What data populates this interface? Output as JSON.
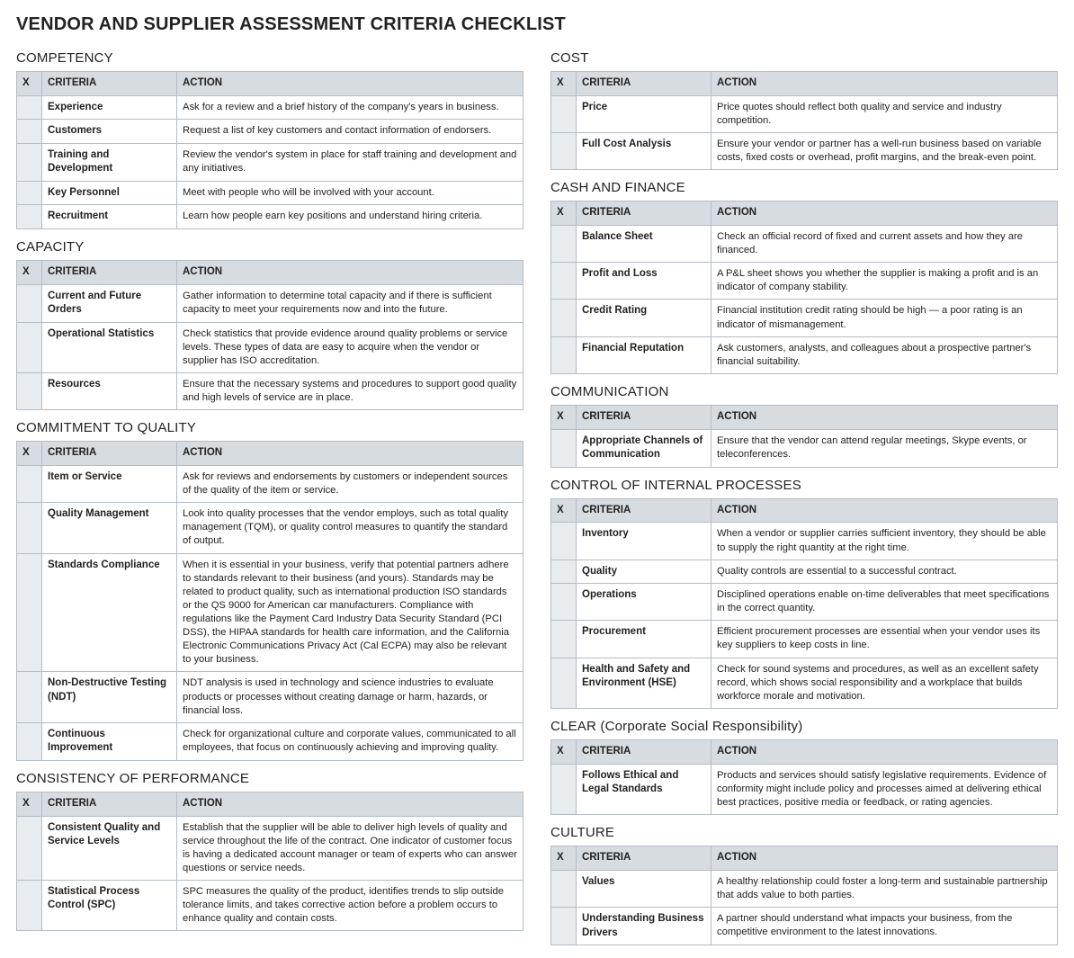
{
  "title": "VENDOR AND SUPPLIER ASSESSMENT CRITERIA CHECKLIST",
  "headers": {
    "x": "X",
    "criteria": "CRITERIA",
    "action": "ACTION"
  },
  "left": [
    {
      "name": "COMPETENCY",
      "rows": [
        {
          "criteria": "Experience",
          "action": "Ask for a review and a brief history of the company's years in business."
        },
        {
          "criteria": "Customers",
          "action": "Request a list of key customers and contact information of endorsers."
        },
        {
          "criteria": "Training and Development",
          "action": "Review the vendor's system in place for staff training and development and any initiatives."
        },
        {
          "criteria": "Key Personnel",
          "action": "Meet with people who will be involved with your account."
        },
        {
          "criteria": "Recruitment",
          "action": "Learn how people earn key positions and understand hiring criteria."
        }
      ]
    },
    {
      "name": "CAPACITY",
      "rows": [
        {
          "criteria": "Current and Future Orders",
          "action": "Gather information to determine total capacity and if there is sufficient capacity to meet your requirements now and into the future."
        },
        {
          "criteria": "Operational Statistics",
          "action": "Check statistics that provide evidence around quality problems or service levels. These types of data are easy to acquire when the vendor or supplier has ISO accreditation."
        },
        {
          "criteria": "Resources",
          "action": "Ensure that the necessary systems and procedures to support good quality and high levels of service are in place."
        }
      ]
    },
    {
      "name": "COMMITMENT TO QUALITY",
      "rows": [
        {
          "criteria": "Item or Service",
          "action": "Ask for reviews and endorsements by customers or independent sources of the quality of the item or service."
        },
        {
          "criteria": "Quality Management",
          "action": "Look into quality processes that the vendor employs, such as total quality management (TQM), or quality control measures to quantify the standard of output."
        },
        {
          "criteria": "Standards Compliance",
          "action": "When it is essential in your business, verify that potential partners adhere to standards relevant to their business (and yours). Standards may be related to product quality, such as international production ISO standards or the QS 9000 for American car manufacturers. Compliance with regulations like the Payment Card Industry Data Security Standard (PCI DSS), the HIPAA standards for health care information, and the California Electronic Communications Privacy Act (Cal ECPA) may also be relevant to your business."
        },
        {
          "criteria": "Non-Destructive Testing (NDT)",
          "action": "NDT analysis is used in technology and science industries to evaluate products or processes without creating damage or harm, hazards, or financial loss."
        },
        {
          "criteria": "Continuous Improvement",
          "action": "Check for organizational culture and corporate values, communicated to all employees, that focus on continuously achieving and improving quality."
        }
      ]
    },
    {
      "name": "CONSISTENCY OF PERFORMANCE",
      "rows": [
        {
          "criteria": "Consistent Quality and Service Levels",
          "action": "Establish that the supplier will be able to deliver high levels of quality and service throughout the life of the contract. One indicator of customer focus is having a dedicated account manager or team of experts who can answer questions or service needs."
        },
        {
          "criteria": "Statistical Process Control (SPC)",
          "action": "SPC measures the quality of the product, identifies trends to slip outside tolerance limits, and takes corrective action before a problem occurs to enhance quality and contain costs."
        }
      ]
    }
  ],
  "right": [
    {
      "name": "COST",
      "rows": [
        {
          "criteria": "Price",
          "action": "Price quotes should reflect both quality and service and industry competition."
        },
        {
          "criteria": "Full Cost Analysis",
          "action": "Ensure your vendor or partner has a well-run business based on variable costs, fixed costs or overhead, profit margins, and the break-even point."
        }
      ]
    },
    {
      "name": "CASH AND FINANCE",
      "rows": [
        {
          "criteria": "Balance Sheet",
          "action": "Check an official record of fixed and current assets and how they are financed."
        },
        {
          "criteria": "Profit and Loss",
          "action": "A P&L sheet shows you whether the supplier is making a profit and is an indicator of company stability."
        },
        {
          "criteria": "Credit Rating",
          "action": "Financial institution credit rating should be high — a poor rating is an indicator of mismanagement."
        },
        {
          "criteria": "Financial Reputation",
          "action": "Ask customers, analysts, and colleagues about a prospective partner's financial suitability."
        }
      ]
    },
    {
      "name": "COMMUNICATION",
      "rows": [
        {
          "criteria": "Appropriate Channels of Communication",
          "action": "Ensure that the vendor can attend regular meetings, Skype events, or teleconferences."
        }
      ]
    },
    {
      "name": "CONTROL OF INTERNAL PROCESSES",
      "rows": [
        {
          "criteria": "Inventory",
          "action": "When a vendor or supplier carries sufficient inventory, they should be able to supply the right quantity at the right time."
        },
        {
          "criteria": "Quality",
          "action": "Quality controls are essential to a successful contract."
        },
        {
          "criteria": "Operations",
          "action": "Disciplined operations enable on-time deliverables that meet specifications in the correct quantity."
        },
        {
          "criteria": "Procurement",
          "action": "Efficient procurement processes are essential when your vendor uses its key suppliers to keep costs in line."
        },
        {
          "criteria": "Health and Safety and Environment (HSE)",
          "action": "Check for sound systems and procedures, as well as an excellent safety record, which shows social responsibility and a workplace that builds workforce morale and motivation."
        }
      ]
    },
    {
      "name": "CLEAR (Corporate Social Responsibility)",
      "rows": [
        {
          "criteria": "Follows Ethical and Legal Standards",
          "action": "Products and services should satisfy legislative requirements. Evidence of conformity might include policy and processes aimed at delivering ethical best practices, positive media or feedback, or rating agencies."
        }
      ]
    },
    {
      "name": "CULTURE",
      "rows": [
        {
          "criteria": "Values",
          "action": "A healthy relationship could foster a long-term and sustainable partnership that adds value to both parties."
        },
        {
          "criteria": "Understanding Business Drivers",
          "action": "A partner should understand what impacts your business, from the competitive environment to the latest innovations."
        }
      ]
    }
  ]
}
